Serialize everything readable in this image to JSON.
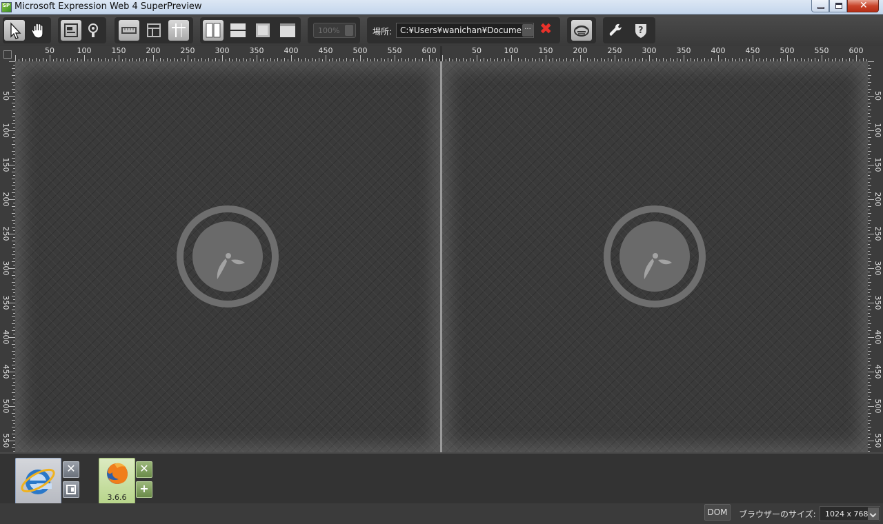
{
  "window": {
    "title": "Microsoft Expression Web 4 SuperPreview",
    "app_icon_text": "SP",
    "controls": [
      "minimize",
      "maximize",
      "close"
    ]
  },
  "toolbar": {
    "tools": [
      {
        "name": "pointer-tool",
        "icon": "arrow-cursor-icon",
        "active": true
      },
      {
        "name": "pan-tool",
        "icon": "hand-icon",
        "active": false
      },
      {
        "name": "dom-highlight",
        "icon": "page-layout-icon",
        "active": true
      },
      {
        "name": "pin",
        "icon": "lightbulb-pin-icon",
        "active": false
      },
      {
        "name": "ruler",
        "icon": "ruler-icon",
        "active": true
      },
      {
        "name": "layout-guides",
        "icon": "layout-grid-icon",
        "active": false
      },
      {
        "name": "guides",
        "icon": "guides-icon",
        "active": true
      },
      {
        "name": "vertical-split",
        "icon": "split-vertical-icon",
        "active": true
      },
      {
        "name": "horizontal-split",
        "icon": "split-horizontal-icon",
        "active": false
      },
      {
        "name": "overlay",
        "icon": "overlay-icon",
        "active": false
      },
      {
        "name": "single-view",
        "icon": "single-view-icon",
        "active": false
      }
    ],
    "zoom": "100%",
    "location_label": "場所:",
    "location_value": "C:¥Users¥wanichan¥Documents",
    "location_more": "···",
    "location_clear": "✖",
    "extra_tools": [
      "remote-browser-icon",
      "wrench-icon",
      "help-icon"
    ]
  },
  "rulers": {
    "horizontal_labels": [
      "50",
      "100",
      "150",
      "200",
      "250",
      "300",
      "350",
      "400",
      "450",
      "500",
      "550",
      "600"
    ],
    "vertical_labels": [
      "50",
      "100",
      "150",
      "200",
      "250",
      "300",
      "350",
      "400",
      "450",
      "500",
      "550"
    ]
  },
  "panes": [
    {
      "name": "left-pane",
      "state": "loading"
    },
    {
      "name": "right-pane",
      "state": "loading"
    }
  ],
  "browsers": [
    {
      "name": "internet-explorer",
      "icon": "ie-icon",
      "selected": true,
      "version": ""
    },
    {
      "name": "firefox",
      "icon": "firefox-icon",
      "selected": true,
      "version": "3.6.6"
    }
  ],
  "status": {
    "dom_button": "DOM",
    "browser_size_label": "ブラウザーのサイズ:",
    "browser_size": "1024 x 768"
  },
  "colors": {
    "background": "#2f2f2f",
    "active_tool": "#cfcfcf",
    "close_red": "#e8312a",
    "ie_selected": "#c8cbd1",
    "ff_selected": "#c8e0a2"
  }
}
